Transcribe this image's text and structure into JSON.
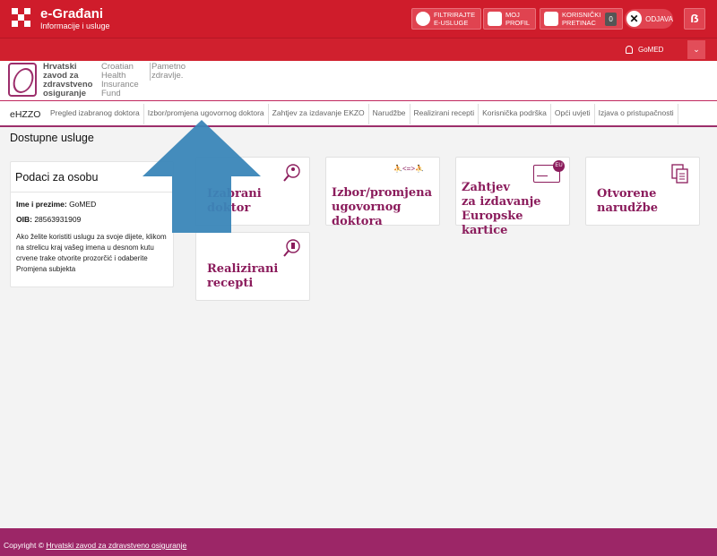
{
  "topbar": {
    "title": "e-Građani",
    "subtitle": "Informacije i usluge",
    "filter_line1": "FILTRIRAJTE",
    "filter_line2": "E-USLUGE",
    "profile_line1": "MOJ",
    "profile_line2": "PROFIL",
    "inbox_line1": "KORISNIČKI",
    "inbox_line2": "PRETINAC",
    "inbox_count": "0",
    "logout": "ODJAVA",
    "currency": "ẞ"
  },
  "userbar": {
    "name": "GoMED",
    "dropdown_icon": "chevron-down-icon"
  },
  "hzzo": {
    "hr_1": "Hrvatski",
    "hr_2": "zavod za",
    "hr_3": "zdravstveno",
    "hr_4": "osiguranje",
    "en_1": "Croatian",
    "en_2": "Health",
    "en_3": "Insurance",
    "en_4": "Fund",
    "pz_1": "Pametno",
    "pz_2": "zdravlje."
  },
  "nav": {
    "brand": "eHZZO",
    "items": [
      "Pregled izabranog doktora",
      "Izbor/promjena ugovornog doktora",
      "Zahtjev za izdavanje EKZO",
      "Narudžbe",
      "Realizirani recepti",
      "Korisnička podrška",
      "Opći uvjeti",
      "Izjava o pristupačnosti"
    ]
  },
  "page_title": "Dostupne usluge",
  "person": {
    "heading": "Podaci za osobu",
    "name_label": "Ime i prezime:",
    "name_value": "GoMED",
    "oib_label": "OIB:",
    "oib_value": "28563931909",
    "note": "Ako želite koristiti uslugu za svoje dijete, klikom na strelicu kraj vašeg imena u desnom kutu crvene trake otvorite prozorčić i odaberite Promjena subjekta"
  },
  "tiles": {
    "t1_a": "Izabrani",
    "t1_b": "doktor",
    "t2_a": "Izbor/promjena",
    "t2_b": "ugovornog doktora",
    "t3_a": "Zahtjev",
    "t3_b": "za izdavanje",
    "t3_c": "Europske kartice",
    "t3_badge": "EU",
    "t4_a": "Otvorene",
    "t4_b": "narudžbe",
    "t5_a": "Realizirani",
    "t5_b": "recepti",
    "swap_symbol": "<=>"
  },
  "footer": {
    "prefix": "Copyright ©",
    "link": "Hrvatski zavod za zdravstveno osiguranje"
  },
  "colors": {
    "top_red": "#cf1c2b",
    "brand_purple": "#9c2e6b",
    "tile_text": "#8b1c5c",
    "arrow_blue": "#3a86b8"
  }
}
